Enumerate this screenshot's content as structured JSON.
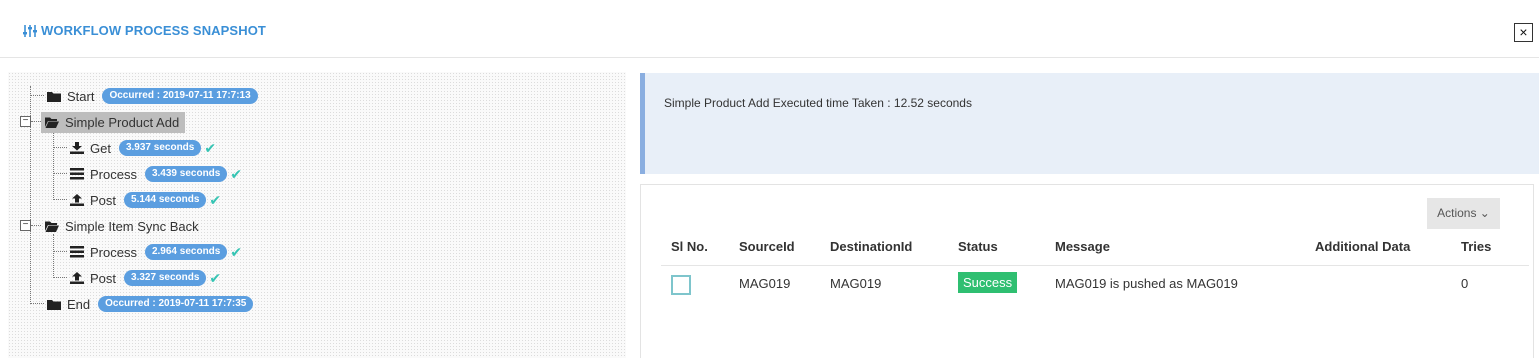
{
  "header": {
    "title": "WORKFLOW PROCESS SNAPSHOT",
    "title_icon": "sliders-icon",
    "close_label": "×",
    "accent_color": "#3a8fd6"
  },
  "tree": {
    "start": {
      "label": "Start",
      "badge": "Occurred : 2019-07-11 17:7:13"
    },
    "group1": {
      "label": "Simple Product Add",
      "expander": "−",
      "children": [
        {
          "label": "Get",
          "badge": "3.937 seconds",
          "icon": "download-icon"
        },
        {
          "label": "Process",
          "badge": "3.439 seconds",
          "icon": "list-icon"
        },
        {
          "label": "Post",
          "badge": "5.144 seconds",
          "icon": "upload-icon"
        }
      ]
    },
    "group2": {
      "label": "Simple Item Sync Back",
      "expander": "−",
      "children": [
        {
          "label": "Process",
          "badge": "2.964 seconds",
          "icon": "list-icon"
        },
        {
          "label": "Post",
          "badge": "3.327 seconds",
          "icon": "upload-icon"
        }
      ]
    },
    "end": {
      "label": "End",
      "badge": "Occurred : 2019-07-11 17:7:35"
    },
    "check_mark": "✔"
  },
  "info": {
    "text": "Simple Product Add Executed time Taken : 12.52 seconds"
  },
  "table": {
    "actions_label": "Actions ⌄",
    "columns": [
      "Sl No.",
      "SourceId",
      "DestinationId",
      "Status",
      "Message",
      "Additional Data",
      "Tries"
    ],
    "rows": [
      {
        "source_id": "MAG019",
        "destination_id": "MAG019",
        "status": "Success",
        "message": "MAG019 is pushed as MAG019",
        "additional_data": "",
        "tries": "0"
      }
    ],
    "status_color": "#2fbf71"
  }
}
